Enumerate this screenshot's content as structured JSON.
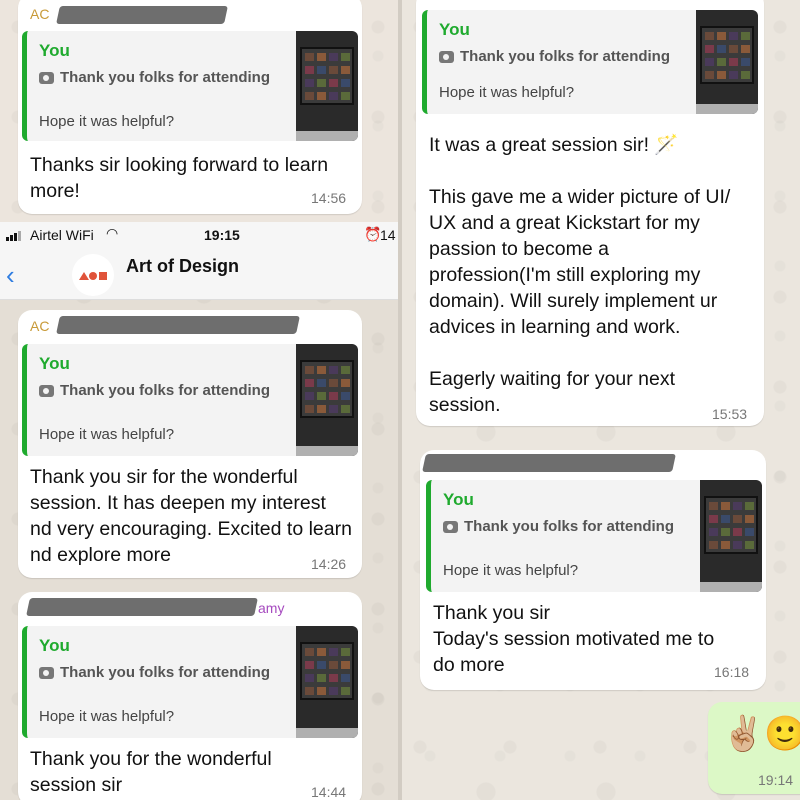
{
  "quote": {
    "you": "You",
    "photo_caption": "Thank you folks for attending",
    "subtext": "Hope it was helpful?"
  },
  "status_bar": {
    "carrier": "Airtel WiFi",
    "time": "19:15",
    "battery_fragment": "14"
  },
  "header": {
    "title": "Art of Design"
  },
  "left_top": {
    "sender_fragment": "AC",
    "message": "Thanks sir looking forward to learn more!",
    "time": "14:56"
  },
  "left_bottom": {
    "messages": [
      {
        "sender_fragment": "AC",
        "text": "Thank you sir for the wonderful session. It has deepen my interest nd very encouraging. Excited to learn nd explore more",
        "time": "14:26"
      },
      {
        "sender_fragment": "amy",
        "text": "Thank you for the wonderful session sir",
        "time": "14:44"
      }
    ]
  },
  "right": {
    "messages": [
      {
        "text_lines": [
          "It was a great session sir! 🪄",
          "",
          "This gave me a wider picture of UI/",
          "UX and a great Kickstart for my",
          "passion to become a",
          "profession(I'm still exploring my",
          "domain). Will surely implement ur",
          "advices in learning and work.",
          "",
          "Eagerly waiting for your next",
          "session."
        ],
        "time": "15:53"
      },
      {
        "text_lines": [
          "Thank you sir",
          "Today's session motivated me to",
          "do more"
        ],
        "time": "16:18"
      }
    ],
    "outgoing": {
      "emojis": "✌🏼🙂",
      "time": "19:14"
    }
  },
  "colors": {
    "quote_accent": "#1faa2e",
    "outgoing_bubble": "#dcf8c6",
    "link_blue": "#2f7de1",
    "sender_gold": "#c89a38",
    "sender_purple": "#a64bbf"
  },
  "icons": [
    "camera-icon",
    "back-chevron-icon",
    "wifi-icon",
    "alarm-icon",
    "signal-icon",
    "group-avatar-icon"
  ]
}
